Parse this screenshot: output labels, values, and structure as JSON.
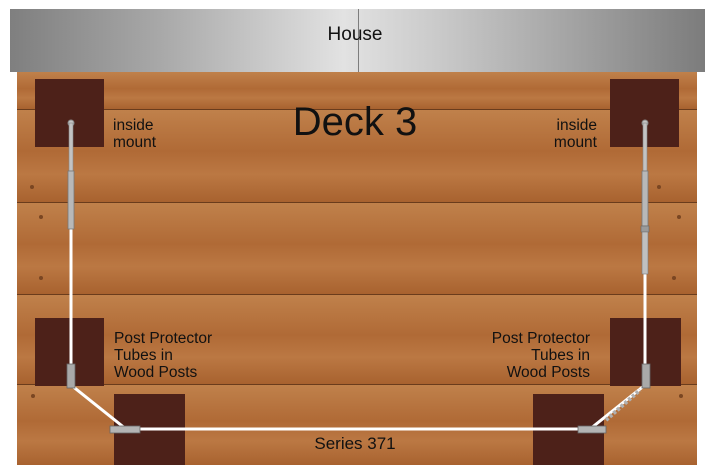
{
  "house": {
    "label": "House"
  },
  "deck": {
    "title": "Deck 3",
    "series": "Series 371"
  },
  "labels": {
    "inside_mount_left": [
      "inside",
      "mount"
    ],
    "inside_mount_right": [
      "inside",
      "mount"
    ],
    "post_protector_left": [
      "Post Protector",
      "Tubes in",
      "Wood Posts"
    ],
    "post_protector_right": [
      "Post Protector",
      "Tubes in",
      "Wood Posts"
    ]
  },
  "colors": {
    "post": "#4d2119",
    "wood": "#b8743e",
    "cable": "#ffffff",
    "hardware": "#b9b9b9"
  }
}
